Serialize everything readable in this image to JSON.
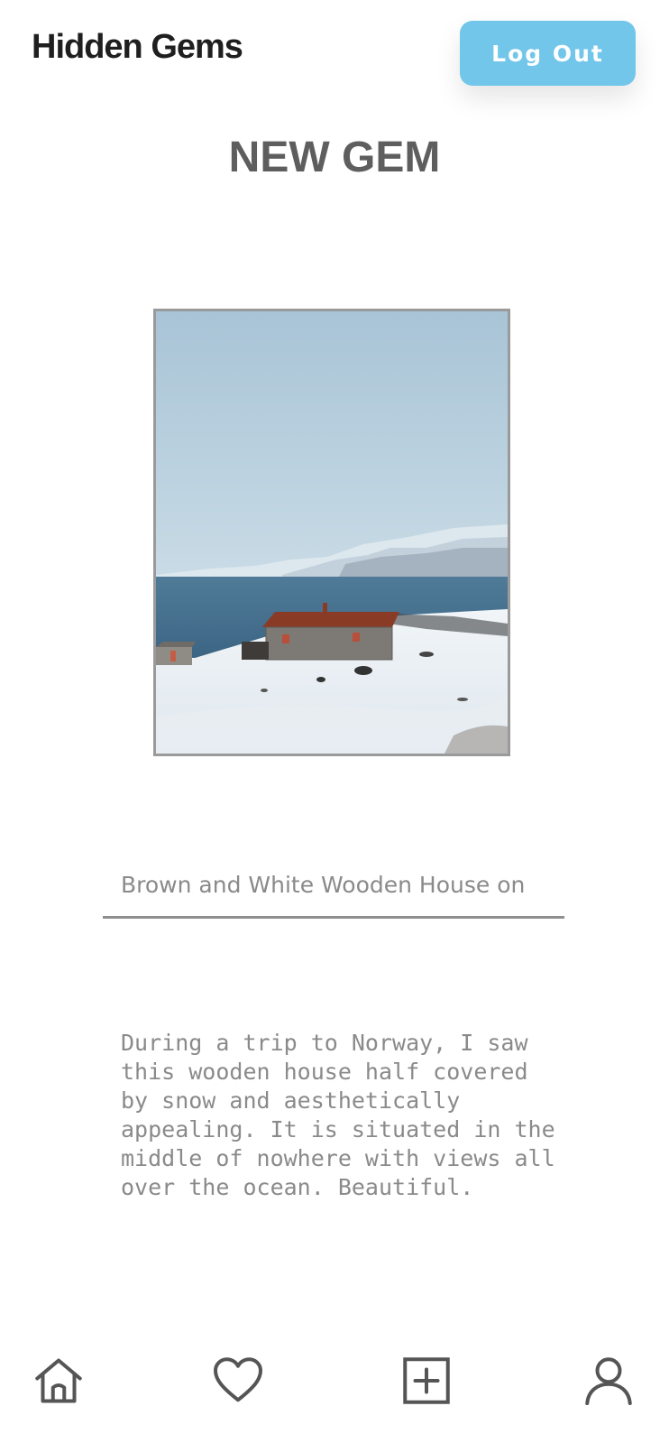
{
  "header": {
    "brand": "Hidden Gems",
    "logout_label": "Log Out"
  },
  "page_title": "NEW GEM",
  "photo": {
    "alt": "Brown and White Wooden House on Snow"
  },
  "form": {
    "name_value": "Brown and White Wooden House on Snow",
    "description_value": "During a trip to Norway, I saw this wooden house half covered by snow and aesthetically appealing. It is situated in the middle of nowhere with views all over the ocean. Beautiful."
  },
  "nav": {
    "items": [
      {
        "icon": "home-icon"
      },
      {
        "icon": "heart-icon"
      },
      {
        "icon": "add-square-icon"
      },
      {
        "icon": "user-icon"
      }
    ]
  },
  "colors": {
    "accent": "#71c6ea",
    "title": "#5e5e5e",
    "muted_text": "#8a8a8a",
    "icon": "#555555"
  }
}
